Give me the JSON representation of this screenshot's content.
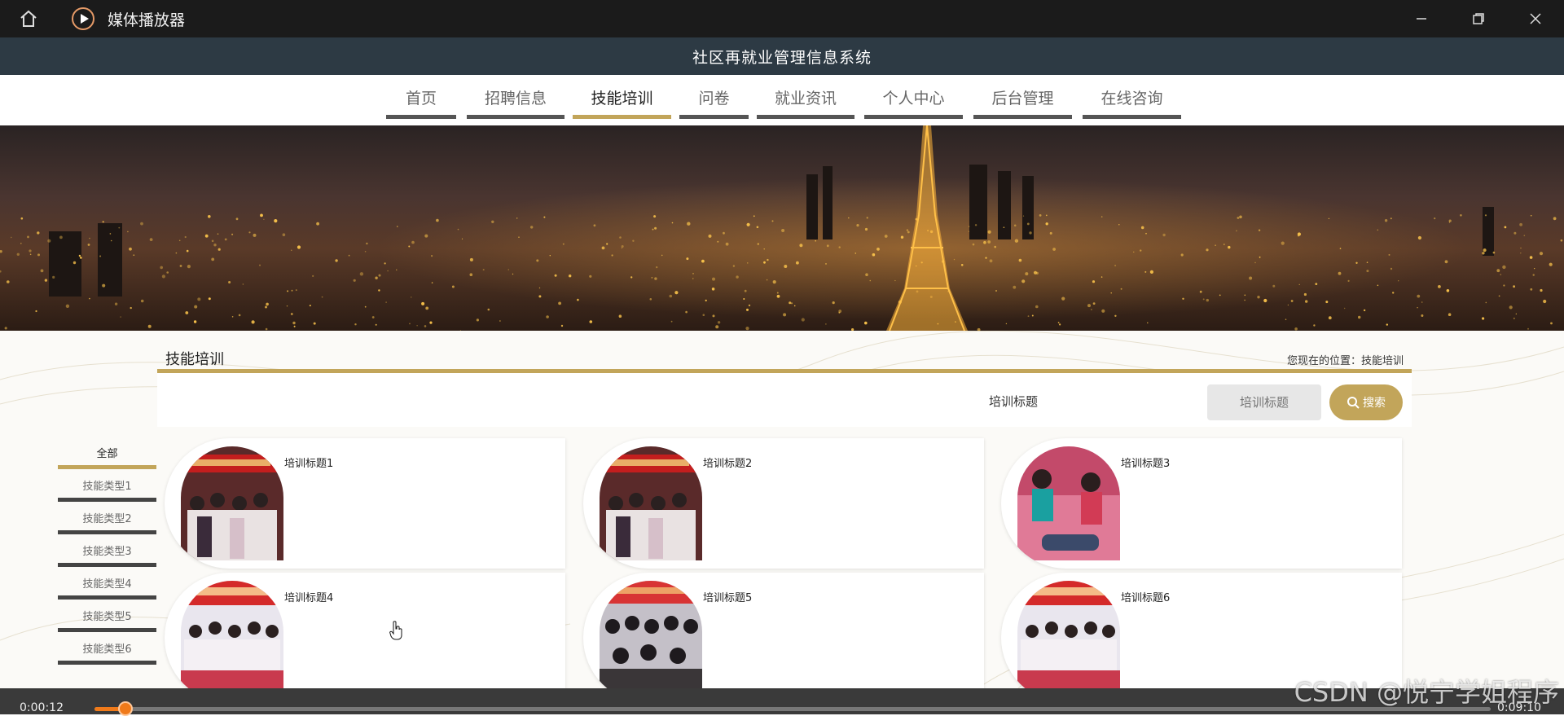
{
  "player": {
    "app_title": "媒体播放器",
    "current_time": "0:00:12",
    "total_time": "0:09:10",
    "progress": 0.022
  },
  "site": {
    "system_title": "社区再就业管理信息系统",
    "nav": [
      {
        "label": "首页",
        "active": false
      },
      {
        "label": "招聘信息",
        "active": false
      },
      {
        "label": "技能培训",
        "active": true
      },
      {
        "label": "问卷",
        "active": false
      },
      {
        "label": "就业资讯",
        "active": false
      },
      {
        "label": "个人中心",
        "active": false
      },
      {
        "label": "后台管理",
        "active": false
      },
      {
        "label": "在线咨询",
        "active": false
      }
    ]
  },
  "section": {
    "title": "技能培训",
    "crumb_prefix": "您现在的位置：",
    "crumb_current": "技能培训"
  },
  "search": {
    "label": "培训标题",
    "placeholder": "培训标题",
    "button_label": "搜索"
  },
  "categories": [
    {
      "label": "全部",
      "active": true
    },
    {
      "label": "技能类型1",
      "active": false
    },
    {
      "label": "技能类型2",
      "active": false
    },
    {
      "label": "技能类型3",
      "active": false
    },
    {
      "label": "技能类型4",
      "active": false
    },
    {
      "label": "技能类型5",
      "active": false
    },
    {
      "label": "技能类型6",
      "active": false
    }
  ],
  "cards": [
    {
      "title": "培训标题1",
      "scene": "banner-meeting"
    },
    {
      "title": "培训标题2",
      "scene": "banner-meeting"
    },
    {
      "title": "培训标题3",
      "scene": "cpr-training"
    },
    {
      "title": "培训标题4",
      "scene": "group-photo"
    },
    {
      "title": "培训标题5",
      "scene": "classroom"
    },
    {
      "title": "培训标题6",
      "scene": "group-photo"
    }
  ],
  "watermark": "CSDN @悦宁学姐程序",
  "colors": {
    "accent": "#c2a55a",
    "header_bg": "#2d3a44",
    "player_accent": "#f07a1a"
  }
}
